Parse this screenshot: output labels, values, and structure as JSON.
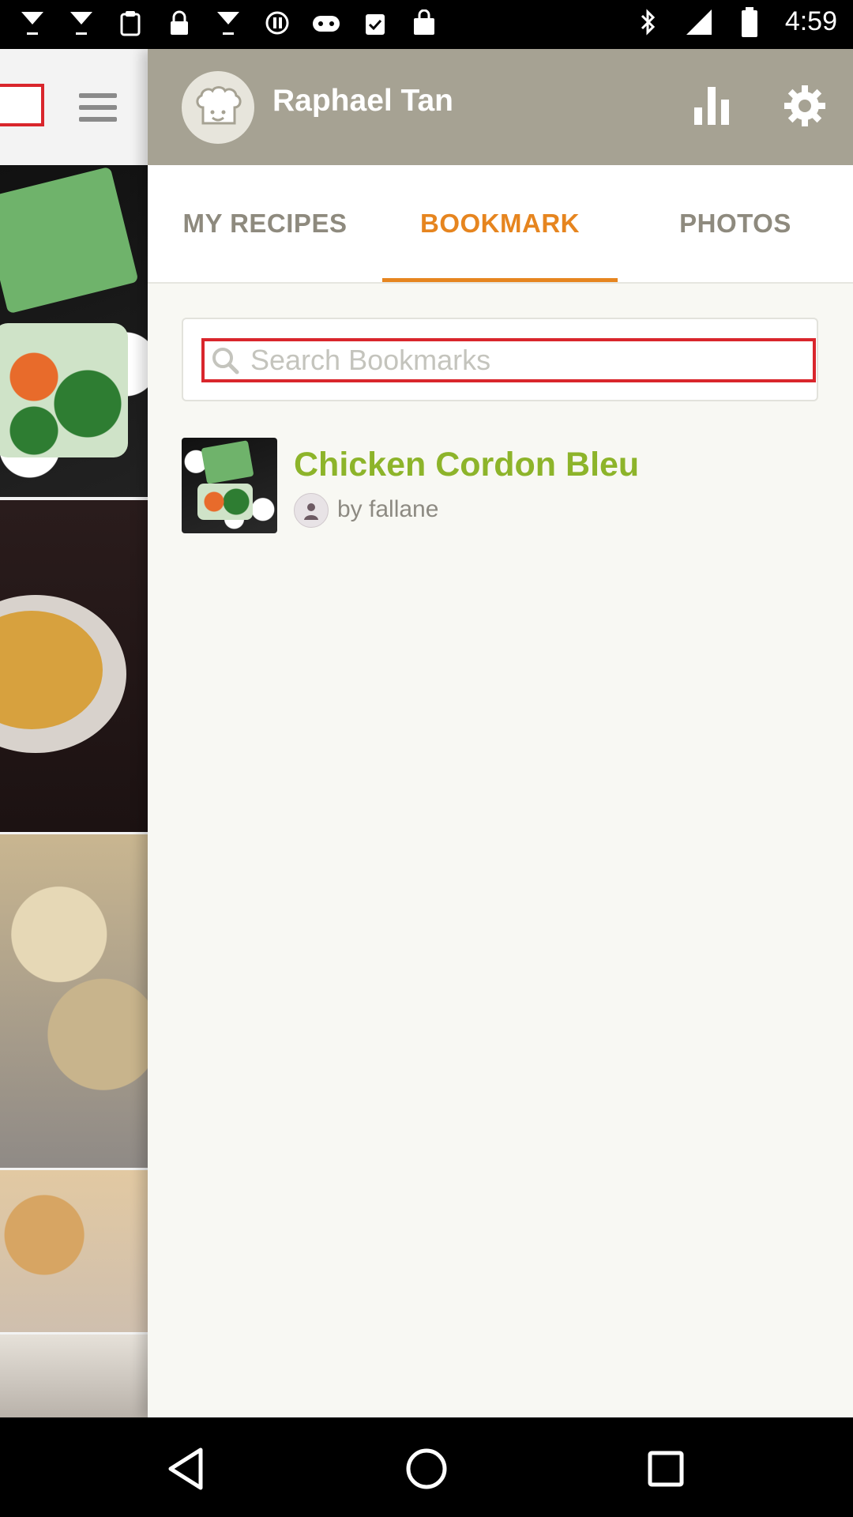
{
  "status_bar": {
    "time": "4:59",
    "left_icons": [
      "cocktail-icon",
      "instagram-icon",
      "clipboard-icon",
      "lock-icon",
      "cocktail-icon",
      "power-icon",
      "game-controller-icon",
      "clipboard-check-icon",
      "shopping-bag-icon"
    ],
    "right_icons": [
      "bluetooth-icon",
      "signal-icon",
      "battery-icon"
    ]
  },
  "drawer": {
    "user_name": "Raphael Tan",
    "tabs": [
      {
        "label": "MY RECIPES",
        "active": false
      },
      {
        "label": "BOOKMARK",
        "active": true
      },
      {
        "label": "PHOTOS",
        "active": false
      }
    ],
    "search": {
      "placeholder": "Search Bookmarks",
      "value": ""
    },
    "bookmarks": [
      {
        "title": "Chicken Cordon Bleu",
        "author": "by fallane"
      }
    ]
  },
  "colors": {
    "header_bg": "#a6a293",
    "accent_orange": "#e6851f",
    "title_green": "#8db42a",
    "highlight_red": "#d9262c",
    "tab_inactive": "#8e8a7e"
  }
}
